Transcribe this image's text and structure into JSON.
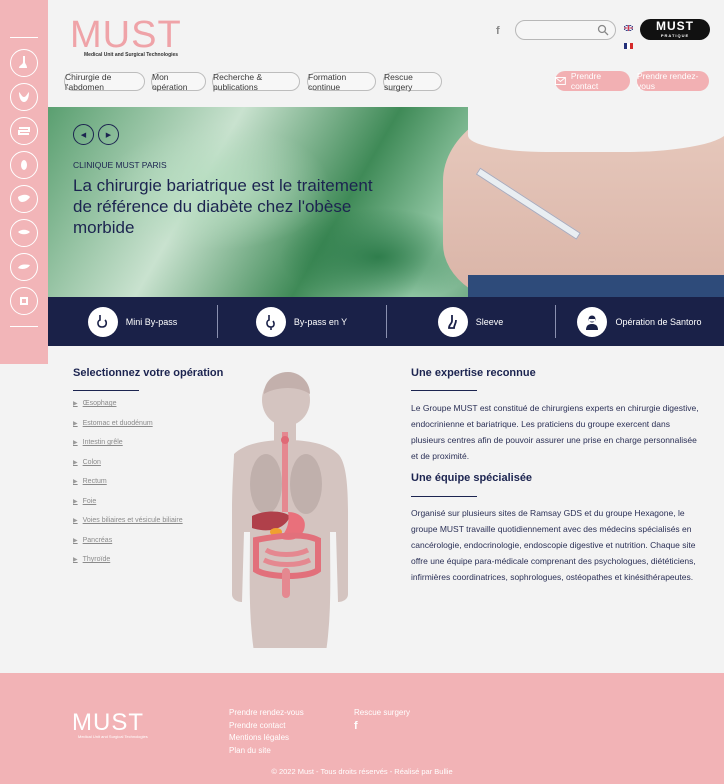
{
  "sidebar": {
    "icons": [
      "esophagus-icon",
      "stomach-icon",
      "intestine-icon",
      "colon-icon",
      "liver-icon",
      "gallbladder-icon",
      "pancreas-icon",
      "thyroid-icon"
    ]
  },
  "header": {
    "logo_word": "MUST",
    "logo_sub": "Medical Unit and Surgical Technologies",
    "search_placeholder": "",
    "badge_word": "MUST",
    "badge_sub": "PRATIQUE"
  },
  "nav": [
    "Chirurgie de l'abdomen",
    "Mon opération",
    "Recherche & publications",
    "Formation continue",
    "Rescue surgery"
  ],
  "cta": {
    "contact": "Prendre contact",
    "rdv": "Prendre rendez-vous"
  },
  "hero": {
    "kicker": "CLINIQUE MUST PARIS",
    "headline": "La chirurgie bariatrique est le traitement de référence du diabète chez l'obèse morbide"
  },
  "operations": [
    {
      "label": "Mini By-pass",
      "icon": "mini-bypass-icon"
    },
    {
      "label": "By-pass en Y",
      "icon": "bypass-y-icon"
    },
    {
      "label": "Sleeve",
      "icon": "sleeve-icon"
    },
    {
      "label": "Opération de Santoro",
      "icon": "surgeon-icon"
    }
  ],
  "select": {
    "title": "Selectionnez votre opération",
    "items": [
      "Œsophage",
      "Estomac et duodénum",
      "Intestin grêle",
      "Colon",
      "Rectum",
      "Foie",
      "Voies biliaires et vésicule biliaire",
      "Pancréas",
      "Thyroïde"
    ]
  },
  "expertise": {
    "title": "Une expertise reconnue",
    "text": "Le Groupe MUST est constitué de chirurgiens experts en chirurgie digestive, endocrinienne et bariatrique. Les praticiens du groupe exercent dans plusieurs centres afin de pouvoir assurer une prise en charge personnalisée et de proximité."
  },
  "team": {
    "title": "Une équipe spécialisée",
    "text": "Organisé sur plusieurs sites de Ramsay GDS et du groupe Hexagone, le groupe MUST travaille quotidiennement avec des médecins spécialisés en cancérologie, endocrinologie, endoscopie digestive et nutrition. Chaque site offre une équipe para-médicale comprenant des psychologues, diététiciens, infirmières coordinatrices, sophrologues, ostéopathes et kinésithérapeutes."
  },
  "footer": {
    "logo_word": "MUST",
    "logo_sub": "Medical Unit and Surgical Technologies",
    "col1": [
      "Prendre rendez-vous",
      "Prendre contact",
      "Mentions légales",
      "Plan du site"
    ],
    "col2": [
      "Rescue surgery"
    ],
    "copyright": "© 2022 Must - Tous droits réservés - Réalisé par Bullie"
  },
  "colors": {
    "pink": "#f2b5b8",
    "navy": "#1a2148"
  }
}
